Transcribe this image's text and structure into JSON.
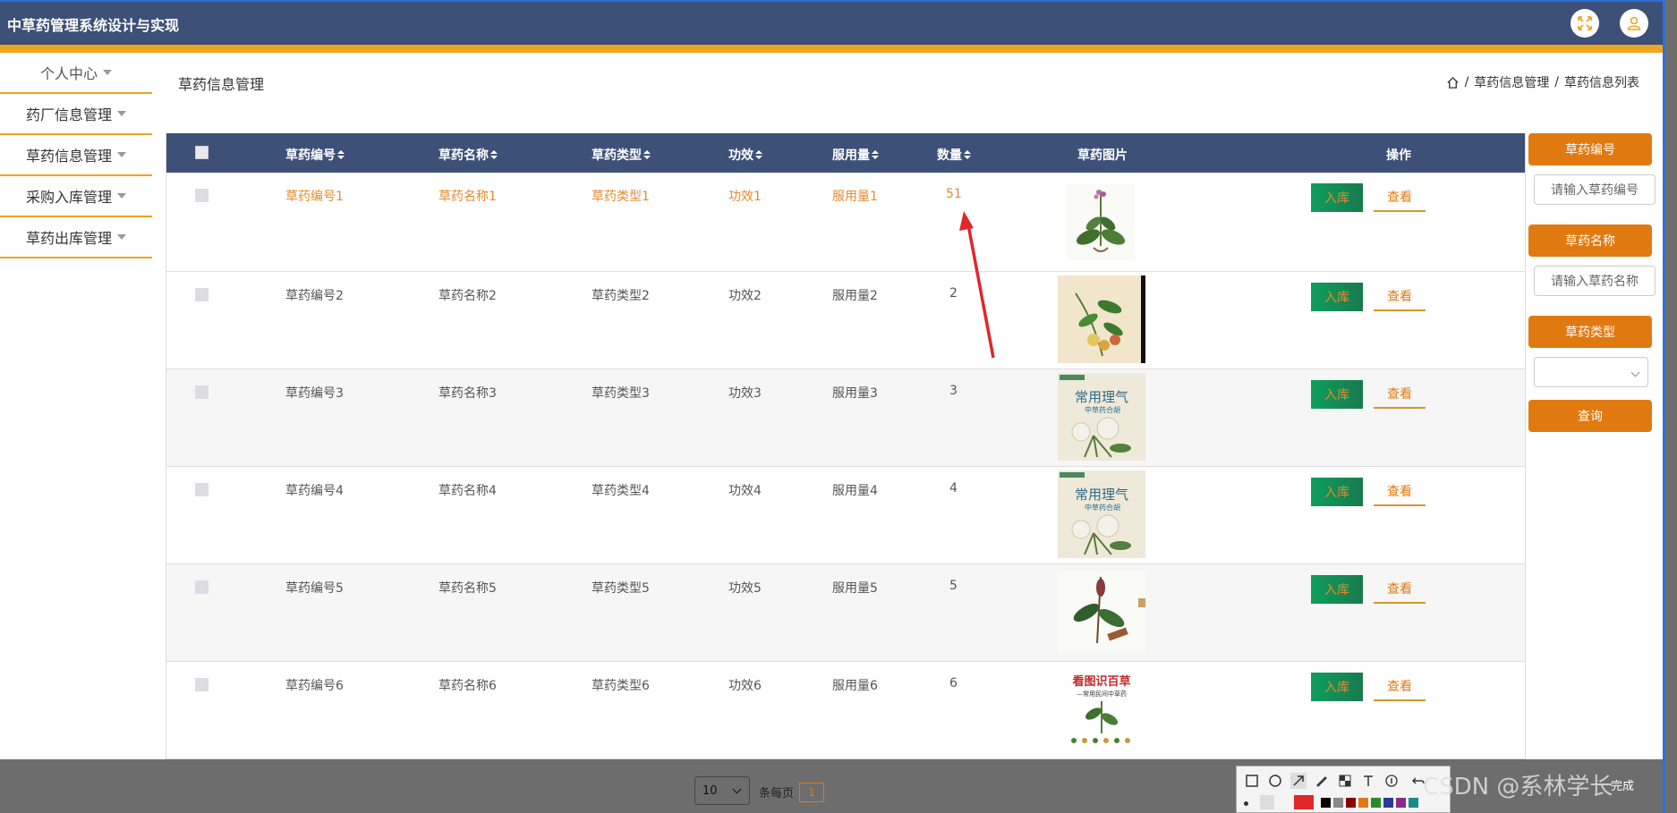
{
  "header": {
    "app_title": "中草药管理系统设计与实现",
    "fullscreen_icon": "fullscreen-icon",
    "user_icon": "user-icon"
  },
  "sidebar": {
    "items": [
      {
        "label": "个人中心"
      },
      {
        "label": "药厂信息管理"
      },
      {
        "label": "草药信息管理"
      },
      {
        "label": "采购入库管理"
      },
      {
        "label": "草药出库管理"
      }
    ]
  },
  "page": {
    "title": "草药信息管理",
    "breadcrumb": [
      "草药信息管理",
      "草药信息列表"
    ],
    "breadcrumb_sep": "/"
  },
  "table": {
    "headers": {
      "code": "草药编号",
      "name": "草药名称",
      "type": "草药类型",
      "effect": "功效",
      "dosage": "服用量",
      "qty": "数量",
      "image": "草药图片",
      "ops": "操作"
    },
    "rows": [
      {
        "code": "草药编号1",
        "name": "草药名称1",
        "type": "草药类型1",
        "effect": "功效1",
        "dosage": "服用量1",
        "qty": "51"
      },
      {
        "code": "草药编号2",
        "name": "草药名称2",
        "type": "草药类型2",
        "effect": "功效2",
        "dosage": "服用量2",
        "qty": "2"
      },
      {
        "code": "草药编号3",
        "name": "草药名称3",
        "type": "草药类型3",
        "effect": "功效3",
        "dosage": "服用量3",
        "qty": "3"
      },
      {
        "code": "草药编号4",
        "name": "草药名称4",
        "type": "草药类型4",
        "effect": "功效4",
        "dosage": "服用量4",
        "qty": "4"
      },
      {
        "code": "草药编号5",
        "name": "草药名称5",
        "type": "草药类型5",
        "effect": "功效5",
        "dosage": "服用量5",
        "qty": "5"
      },
      {
        "code": "草药编号6",
        "name": "草药名称6",
        "type": "草药类型6",
        "effect": "功效6",
        "dosage": "服用量6",
        "qty": "6"
      }
    ],
    "btn_in": "入库",
    "btn_view": "查看"
  },
  "images": {
    "book_title_a": "常用理气",
    "book_sub_a": "中草药合胡",
    "book_title_b": "看图识百草",
    "book_sub_b": "—常用民间中草药"
  },
  "search": {
    "code_label": "草药编号",
    "code_placeholder": "请输入草药编号",
    "name_label": "草药名称",
    "name_placeholder": "请输入草药名称",
    "type_label": "草药类型",
    "query_btn": "查询"
  },
  "pager": {
    "page_size": "10",
    "per_page_label": "条每页",
    "current_page": "1"
  },
  "overlay": {
    "watermark": "CSDN @系林学长",
    "done_label": "完成"
  },
  "colors": {
    "header_bg": "#3c5078",
    "accent_orange": "#e07a10",
    "border_orange": "#f0a51e",
    "btn_green": "#0e9e5c"
  }
}
